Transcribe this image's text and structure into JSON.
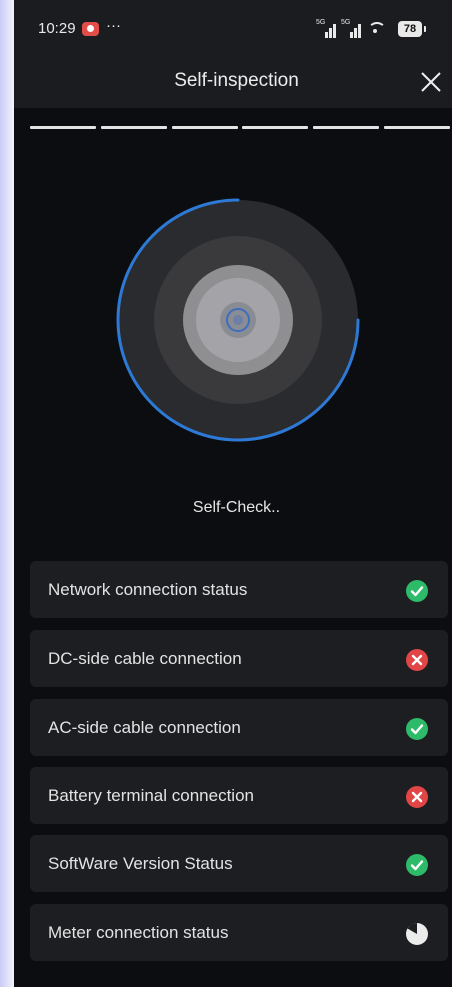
{
  "status_bar": {
    "time": "10:29",
    "more": "···",
    "network_1": "5G",
    "network_2": "5G",
    "battery": "78"
  },
  "header": {
    "title": "Self-inspection"
  },
  "progress": {
    "segments_total": 6,
    "segments_done": 6
  },
  "check": {
    "label": "Self-Check..",
    "progress_fraction": 0.75,
    "accent_color": "#2d7ad6"
  },
  "items": [
    {
      "label": "Network connection status",
      "status": "pass",
      "icon": "check-circle-icon"
    },
    {
      "label": "DC-side cable connection",
      "status": "fail",
      "icon": "x-circle-icon"
    },
    {
      "label": "AC-side cable connection",
      "status": "pass",
      "icon": "check-circle-icon"
    },
    {
      "label": "Battery terminal connection",
      "status": "fail",
      "icon": "x-circle-icon"
    },
    {
      "label": "SoftWare Version Status",
      "status": "pass",
      "icon": "check-circle-icon"
    },
    {
      "label": "Meter connection status",
      "status": "pending",
      "icon": "loading-pie-icon"
    }
  ],
  "colors": {
    "pass": "#2dbb6a",
    "fail": "#e14545",
    "pending": "#ececec",
    "background": "#0c0d10",
    "card": "#1d1e22"
  }
}
